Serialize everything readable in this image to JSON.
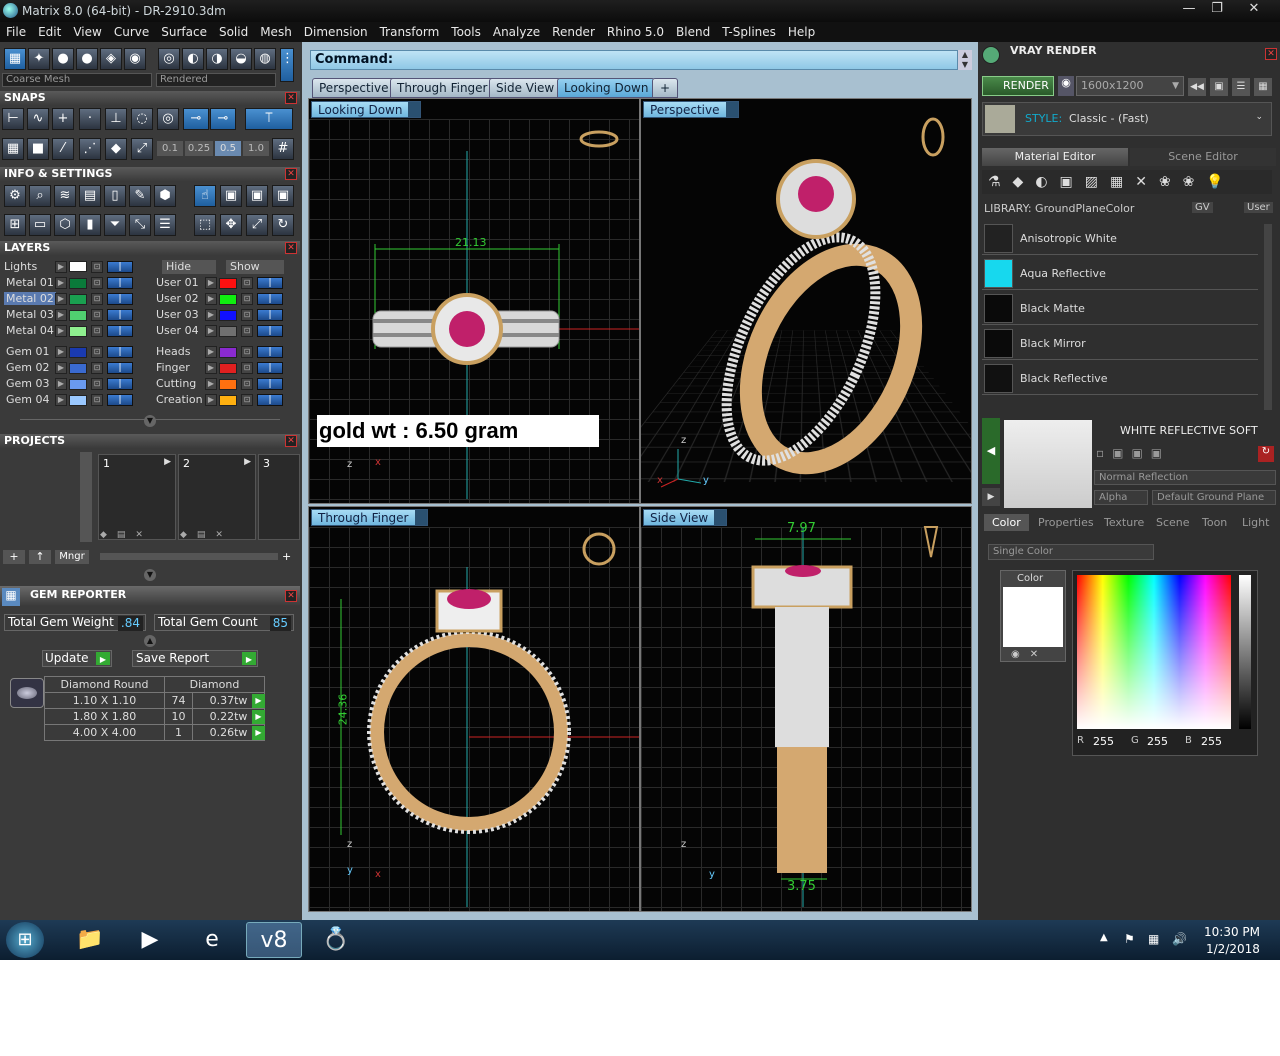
{
  "window": {
    "title": "Matrix 8.0 (64-bit) - DR-2910.3dm",
    "controls": [
      "—",
      "❐",
      "✕"
    ]
  },
  "menu": [
    "File",
    "Edit",
    "View",
    "Curve",
    "Surface",
    "Solid",
    "Mesh",
    "Dimension",
    "Transform",
    "Tools",
    "Analyze",
    "Render",
    "Rhino 5.0",
    "Blend",
    "T-Splines",
    "Help"
  ],
  "left": {
    "mesh_mode": "Coarse Mesh",
    "render_mode": "Rendered",
    "snaps_title": "SNAPS",
    "snap_values": [
      "0.1",
      "0.25",
      "0.5",
      "1.0"
    ],
    "info_title": "INFO & SETTINGS",
    "layers_title": "LAYERS",
    "lights_label": "Lights",
    "hide_label": "Hide",
    "show_label": "Show",
    "layers_left": [
      {
        "name": "Metal 01",
        "color": "#0a7a3a",
        "selected": false
      },
      {
        "name": "Metal 02",
        "color": "#1aa050",
        "selected": true
      },
      {
        "name": "Metal 03",
        "color": "#50d070",
        "selected": false
      },
      {
        "name": "Metal 04",
        "color": "#8ff08f",
        "selected": false
      },
      {
        "name": "Gem 01",
        "color": "#1a3ab0",
        "selected": false
      },
      {
        "name": "Gem 02",
        "color": "#3a6ad0",
        "selected": false
      },
      {
        "name": "Gem 03",
        "color": "#6a9af0",
        "selected": false
      },
      {
        "name": "Gem 04",
        "color": "#9ac8ff",
        "selected": false
      }
    ],
    "layers_right": [
      {
        "name": "User 01",
        "color": "#ff1010"
      },
      {
        "name": "User 02",
        "color": "#10ee10"
      },
      {
        "name": "User 03",
        "color": "#1010ff"
      },
      {
        "name": "User 04",
        "color": "#707070"
      },
      {
        "name": "Heads",
        "color": "#8a2ad0"
      },
      {
        "name": "Finger",
        "color": "#e02020"
      },
      {
        "name": "Cutting",
        "color": "#ff7010"
      },
      {
        "name": "Creation",
        "color": "#ffb010"
      }
    ],
    "projects_title": "PROJECTS",
    "projects": [
      "1",
      "2",
      "3"
    ],
    "mngr_label": "Mngr",
    "gem_reporter": {
      "title": "GEM REPORTER",
      "weight_label": "Total Gem Weight",
      "weight": ".84",
      "count_label": "Total Gem Count",
      "count": "85",
      "update_label": "Update",
      "save_label": "Save Report",
      "columns": [
        "Diamond Round",
        "Diamond"
      ],
      "rows": [
        {
          "size": "1.10 X 1.10",
          "qty": "74",
          "wt": "0.37tw"
        },
        {
          "size": "1.80 X 1.80",
          "qty": "10",
          "wt": "0.22tw"
        },
        {
          "size": "4.00 X 4.00",
          "qty": "1",
          "wt": "0.26tw"
        }
      ]
    }
  },
  "center": {
    "command_label": "Command:",
    "tabs": [
      {
        "label": "Perspective",
        "active": false
      },
      {
        "label": "Through Finger",
        "active": false
      },
      {
        "label": "Side View",
        "active": false
      },
      {
        "label": "Looking Down",
        "active": true
      }
    ],
    "add_tab": "+",
    "viewports": {
      "top_left": {
        "label": "Looking Down",
        "dim": "21.13",
        "note": "gold wt : 6.50 gram",
        "axis_a": "z",
        "axis_b": "x"
      },
      "top_right": {
        "label": "Perspective",
        "axis_a": "z",
        "axis_b": "y",
        "axis_c": "x"
      },
      "bottom_left": {
        "label": "Through Finger",
        "dim": "24.36",
        "axis_a": "z",
        "axis_b": "y",
        "axis_c": "x"
      },
      "bottom_right": {
        "label": "Side View",
        "dim_top": "7.97",
        "dim_bottom": "3.75",
        "axis_a": "z",
        "axis_b": "y"
      }
    }
  },
  "right": {
    "title": "VRAY RENDER",
    "render_label": "RENDER",
    "resolution": "1600x1200",
    "style_label": "STYLE:",
    "style_value": "Classic - (Fast)",
    "tabs": [
      "Material Editor",
      "Scene Editor"
    ],
    "library_label": "LIBRARY: GroundPlaneColor",
    "gv_label": "GV",
    "user_label": "User",
    "materials": [
      {
        "name": "Anisotropic White",
        "color": "#222"
      },
      {
        "name": "Aqua Reflective",
        "color": "#17d8ee"
      },
      {
        "name": "Black Matte",
        "color": "#0a0a0a"
      },
      {
        "name": "Black Mirror",
        "color": "#0a0a0a"
      },
      {
        "name": "Black Reflective",
        "color": "#111"
      }
    ],
    "selected_material": "WHITE REFLECTIVE SOFT",
    "reflection": "Normal Reflection",
    "alpha_label": "Alpha",
    "ground": "Default Ground Plane",
    "prop_tabs": [
      "Color",
      "Properties",
      "Texture",
      "Scene",
      "Toon",
      "Light"
    ],
    "color_mode": "Single Color",
    "color_label": "Color",
    "rgb": {
      "r_label": "R",
      "r": "255",
      "g_label": "G",
      "g": "255",
      "b_label": "B",
      "b": "255"
    }
  },
  "taskbar": {
    "time": "10:30 PM",
    "date": "1/2/2018"
  }
}
